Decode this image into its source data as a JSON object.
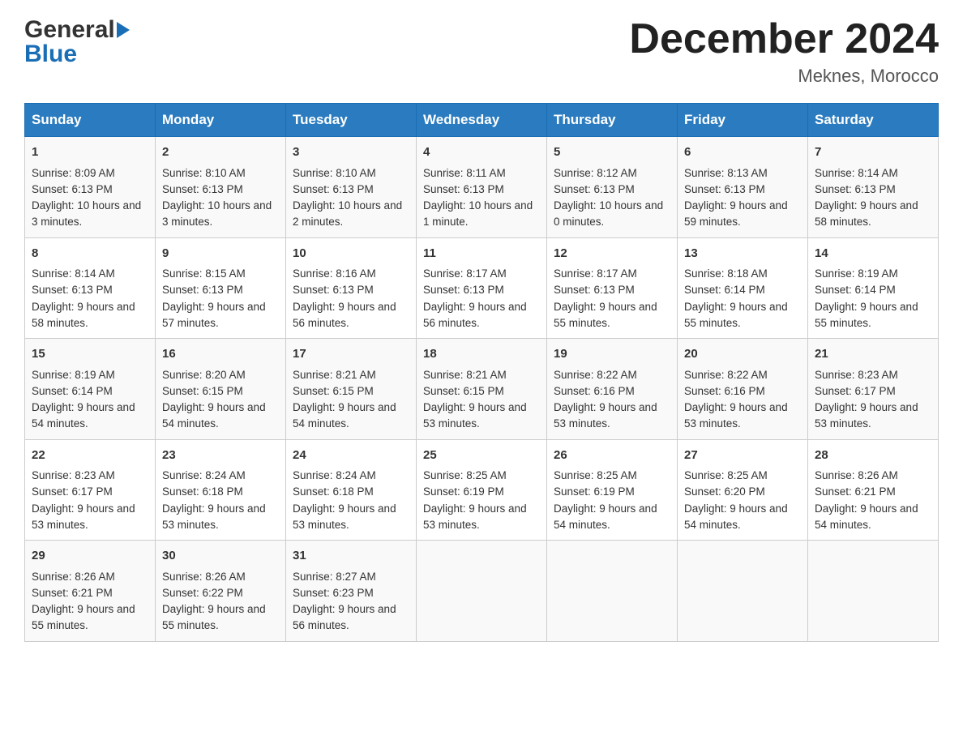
{
  "header": {
    "month_year": "December 2024",
    "location": "Meknes, Morocco",
    "logo_general": "General",
    "logo_blue": "Blue"
  },
  "days_of_week": [
    "Sunday",
    "Monday",
    "Tuesday",
    "Wednesday",
    "Thursday",
    "Friday",
    "Saturday"
  ],
  "weeks": [
    [
      {
        "day": "1",
        "sunrise": "8:09 AM",
        "sunset": "6:13 PM",
        "daylight": "10 hours and 3 minutes."
      },
      {
        "day": "2",
        "sunrise": "8:10 AM",
        "sunset": "6:13 PM",
        "daylight": "10 hours and 3 minutes."
      },
      {
        "day": "3",
        "sunrise": "8:10 AM",
        "sunset": "6:13 PM",
        "daylight": "10 hours and 2 minutes."
      },
      {
        "day": "4",
        "sunrise": "8:11 AM",
        "sunset": "6:13 PM",
        "daylight": "10 hours and 1 minute."
      },
      {
        "day": "5",
        "sunrise": "8:12 AM",
        "sunset": "6:13 PM",
        "daylight": "10 hours and 0 minutes."
      },
      {
        "day": "6",
        "sunrise": "8:13 AM",
        "sunset": "6:13 PM",
        "daylight": "9 hours and 59 minutes."
      },
      {
        "day": "7",
        "sunrise": "8:14 AM",
        "sunset": "6:13 PM",
        "daylight": "9 hours and 58 minutes."
      }
    ],
    [
      {
        "day": "8",
        "sunrise": "8:14 AM",
        "sunset": "6:13 PM",
        "daylight": "9 hours and 58 minutes."
      },
      {
        "day": "9",
        "sunrise": "8:15 AM",
        "sunset": "6:13 PM",
        "daylight": "9 hours and 57 minutes."
      },
      {
        "day": "10",
        "sunrise": "8:16 AM",
        "sunset": "6:13 PM",
        "daylight": "9 hours and 56 minutes."
      },
      {
        "day": "11",
        "sunrise": "8:17 AM",
        "sunset": "6:13 PM",
        "daylight": "9 hours and 56 minutes."
      },
      {
        "day": "12",
        "sunrise": "8:17 AM",
        "sunset": "6:13 PM",
        "daylight": "9 hours and 55 minutes."
      },
      {
        "day": "13",
        "sunrise": "8:18 AM",
        "sunset": "6:14 PM",
        "daylight": "9 hours and 55 minutes."
      },
      {
        "day": "14",
        "sunrise": "8:19 AM",
        "sunset": "6:14 PM",
        "daylight": "9 hours and 55 minutes."
      }
    ],
    [
      {
        "day": "15",
        "sunrise": "8:19 AM",
        "sunset": "6:14 PM",
        "daylight": "9 hours and 54 minutes."
      },
      {
        "day": "16",
        "sunrise": "8:20 AM",
        "sunset": "6:15 PM",
        "daylight": "9 hours and 54 minutes."
      },
      {
        "day": "17",
        "sunrise": "8:21 AM",
        "sunset": "6:15 PM",
        "daylight": "9 hours and 54 minutes."
      },
      {
        "day": "18",
        "sunrise": "8:21 AM",
        "sunset": "6:15 PM",
        "daylight": "9 hours and 53 minutes."
      },
      {
        "day": "19",
        "sunrise": "8:22 AM",
        "sunset": "6:16 PM",
        "daylight": "9 hours and 53 minutes."
      },
      {
        "day": "20",
        "sunrise": "8:22 AM",
        "sunset": "6:16 PM",
        "daylight": "9 hours and 53 minutes."
      },
      {
        "day": "21",
        "sunrise": "8:23 AM",
        "sunset": "6:17 PM",
        "daylight": "9 hours and 53 minutes."
      }
    ],
    [
      {
        "day": "22",
        "sunrise": "8:23 AM",
        "sunset": "6:17 PM",
        "daylight": "9 hours and 53 minutes."
      },
      {
        "day": "23",
        "sunrise": "8:24 AM",
        "sunset": "6:18 PM",
        "daylight": "9 hours and 53 minutes."
      },
      {
        "day": "24",
        "sunrise": "8:24 AM",
        "sunset": "6:18 PM",
        "daylight": "9 hours and 53 minutes."
      },
      {
        "day": "25",
        "sunrise": "8:25 AM",
        "sunset": "6:19 PM",
        "daylight": "9 hours and 53 minutes."
      },
      {
        "day": "26",
        "sunrise": "8:25 AM",
        "sunset": "6:19 PM",
        "daylight": "9 hours and 54 minutes."
      },
      {
        "day": "27",
        "sunrise": "8:25 AM",
        "sunset": "6:20 PM",
        "daylight": "9 hours and 54 minutes."
      },
      {
        "day": "28",
        "sunrise": "8:26 AM",
        "sunset": "6:21 PM",
        "daylight": "9 hours and 54 minutes."
      }
    ],
    [
      {
        "day": "29",
        "sunrise": "8:26 AM",
        "sunset": "6:21 PM",
        "daylight": "9 hours and 55 minutes."
      },
      {
        "day": "30",
        "sunrise": "8:26 AM",
        "sunset": "6:22 PM",
        "daylight": "9 hours and 55 minutes."
      },
      {
        "day": "31",
        "sunrise": "8:27 AM",
        "sunset": "6:23 PM",
        "daylight": "9 hours and 56 minutes."
      },
      null,
      null,
      null,
      null
    ]
  ],
  "labels": {
    "sunrise": "Sunrise:",
    "sunset": "Sunset:",
    "daylight": "Daylight:"
  }
}
